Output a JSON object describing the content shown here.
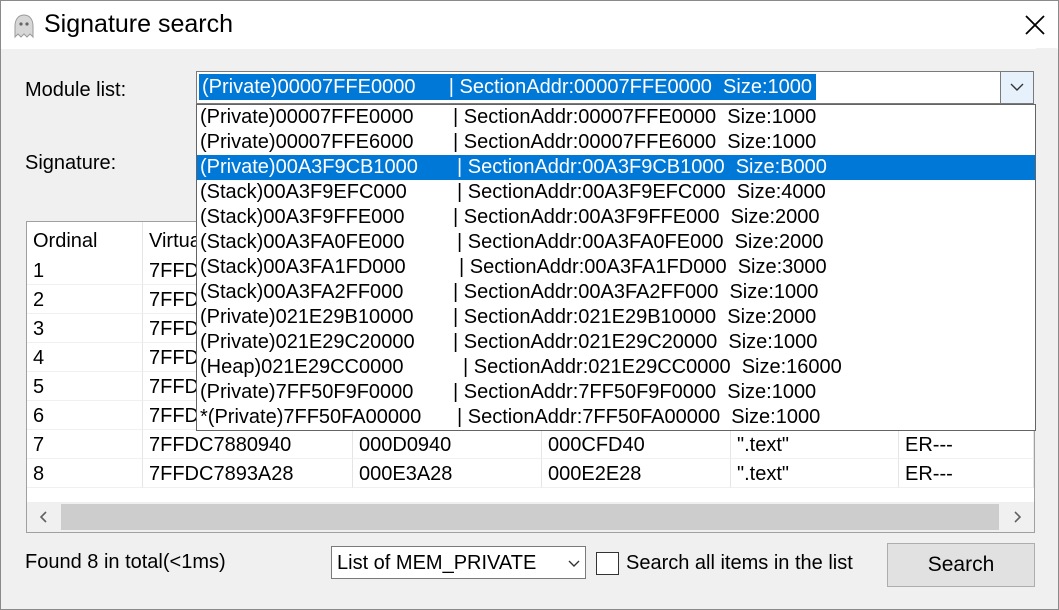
{
  "window": {
    "title": "Signature search",
    "close_glyph": "✕"
  },
  "labels": {
    "module_list": "Module list:",
    "signature": "Signature:"
  },
  "module_combo": {
    "selected": "(Private)00007FFE0000      | SectionAddr:00007FFE0000  Size:1000"
  },
  "dropdown": {
    "selected_index": 2,
    "items": [
      [
        "(Private)00007FFE0000",
        "| SectionAddr:00007FFE0000  Size:1000"
      ],
      [
        "(Private)00007FFE6000",
        "| SectionAddr:00007FFE6000  Size:1000"
      ],
      [
        "(Private)00A3F9CB1000",
        "| SectionAddr:00A3F9CB1000  Size:B000"
      ],
      [
        "(Stack)00A3F9EFC000",
        "| SectionAddr:00A3F9EFC000  Size:4000"
      ],
      [
        "(Stack)00A3F9FFE000",
        "| SectionAddr:00A3F9FFE000  Size:2000"
      ],
      [
        "(Stack)00A3FA0FE000",
        "| SectionAddr:00A3FA0FE000  Size:2000"
      ],
      [
        "(Stack)00A3FA1FD000",
        "| SectionAddr:00A3FA1FD000  Size:3000"
      ],
      [
        "(Stack)00A3FA2FF000",
        "| SectionAddr:00A3FA2FF000  Size:1000"
      ],
      [
        "(Private)021E29B10000",
        "| SectionAddr:021E29B10000  Size:2000"
      ],
      [
        "(Private)021E29C20000",
        "| SectionAddr:021E29C20000  Size:1000"
      ],
      [
        "(Heap)021E29CC0000",
        "| SectionAddr:021E29CC0000  Size:16000"
      ],
      [
        "(Private)7FF50F9F0000",
        "| SectionAddr:7FF50F9F0000  Size:1000"
      ],
      [
        "*(Private)7FF50FA00000",
        "| SectionAddr:7FF50FA00000  Size:1000"
      ]
    ]
  },
  "table": {
    "headers": [
      "Ordinal",
      "Virtual",
      "",
      "",
      "",
      ""
    ],
    "rows": [
      [
        "1",
        "7FFD",
        "",
        "",
        "",
        ""
      ],
      [
        "2",
        "7FFD",
        "",
        "",
        "",
        ""
      ],
      [
        "3",
        "7FFD",
        "",
        "",
        "",
        ""
      ],
      [
        "4",
        "7FFD",
        "",
        "",
        "",
        ""
      ],
      [
        "5",
        "7FFD",
        "",
        "",
        "",
        ""
      ],
      [
        "6",
        "7FFD",
        "",
        "",
        "",
        ""
      ],
      [
        "7",
        "7FFDC7880940",
        "000D0940",
        "000CFD40",
        "\".text\"",
        "ER---"
      ],
      [
        "8",
        "7FFDC7893A28",
        "000E3A28",
        "000E2E28",
        "\".text\"",
        "ER---"
      ]
    ]
  },
  "scroll": {
    "left_glyph": "‹",
    "right_glyph": "›"
  },
  "footer": {
    "status": "Found 8 in total(<1ms)",
    "filter_value": "List of MEM_PRIVATE",
    "checkbox_label": "Search all items in the list",
    "checkbox_checked": false,
    "search_button": "Search"
  },
  "colors": {
    "selection": "#0078d7",
    "window_bg": "#f0f0f0"
  },
  "icons": [
    "app-ghost-icon",
    "close-icon",
    "chevron-down-icon",
    "scroll-left-icon",
    "scroll-right-icon"
  ]
}
